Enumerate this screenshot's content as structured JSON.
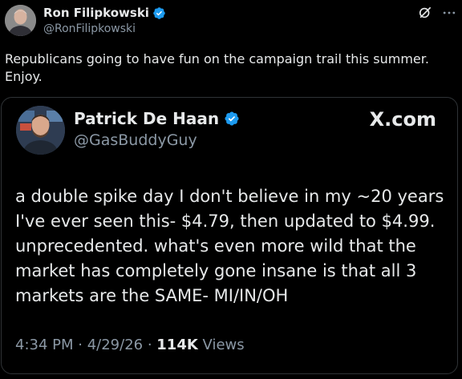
{
  "author": {
    "name": "Ron Filipkowski",
    "handle": "@RonFilipkowski"
  },
  "tweet": {
    "text": "Republicans going to have fun on the campaign trail this summer. Enjoy."
  },
  "quoted": {
    "name": "Patrick De Haan",
    "handle": "@GasBuddyGuy",
    "source": "X.com",
    "text": "a double spike day I don't believe in my ~20 years I've ever seen this- $4.79, then updated to $4.99. unprecedented. what's even more wild that the market has completely gone insane is that all 3 markets are the SAME- MI/IN/OH",
    "time": "4:34 PM",
    "date": "4/29/26",
    "views_count": "114K",
    "views_label": "Views"
  },
  "colors": {
    "verified": "#1d9bf0",
    "secondary_text": "#8b98a5",
    "border": "#2f3336"
  },
  "icons": [
    "verified-badge-icon",
    "grok-icon",
    "more-options-icon"
  ]
}
